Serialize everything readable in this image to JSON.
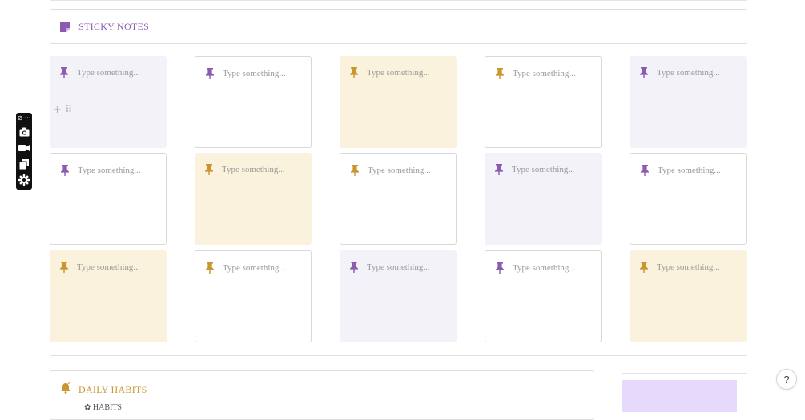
{
  "sticky_notes": {
    "title": "STICKY NOTES",
    "icon": "sticky-note-icon",
    "accent": "#8b5bb0",
    "notes": [
      {
        "placeholder": "Type something...",
        "color": "lavender",
        "pin": "#8b5bb0"
      },
      {
        "placeholder": "Type something...",
        "color": "white",
        "pin": "#8b5bb0"
      },
      {
        "placeholder": "Type something...",
        "color": "yellow",
        "pin": "#c8952e"
      },
      {
        "placeholder": "Type something...",
        "color": "white",
        "pin": "#c8952e"
      },
      {
        "placeholder": "Type something...",
        "color": "lavender",
        "pin": "#8b5bb0"
      },
      {
        "placeholder": "Type something...",
        "color": "white",
        "pin": "#8b5bb0"
      },
      {
        "placeholder": "Type something...",
        "color": "yellow",
        "pin": "#c8952e"
      },
      {
        "placeholder": "Type something...",
        "color": "white",
        "pin": "#c8952e"
      },
      {
        "placeholder": "Type something...",
        "color": "lavender",
        "pin": "#8b5bb0"
      },
      {
        "placeholder": "Type something...",
        "color": "white",
        "pin": "#8b5bb0"
      },
      {
        "placeholder": "Type something...",
        "color": "yellow",
        "pin": "#c8952e"
      },
      {
        "placeholder": "Type something...",
        "color": "white",
        "pin": "#c8952e"
      },
      {
        "placeholder": "Type something...",
        "color": "lavender",
        "pin": "#8b5bb0"
      },
      {
        "placeholder": "Type something...",
        "color": "white",
        "pin": "#8b5bb0"
      },
      {
        "placeholder": "Type something...",
        "color": "yellow",
        "pin": "#c8952e"
      }
    ]
  },
  "block_handle": {
    "add": "+",
    "drag": "⠿"
  },
  "daily_habits": {
    "title": "DAILY HABITS",
    "icon": "bell-icon",
    "accent": "#c8952e",
    "sub_heading": "✿ HABITS"
  },
  "toolbar": {
    "menu": "⊘ ···",
    "items": [
      "camera-icon",
      "video-icon",
      "copy-icon",
      "gear-icon"
    ]
  },
  "help": {
    "label": "?"
  }
}
